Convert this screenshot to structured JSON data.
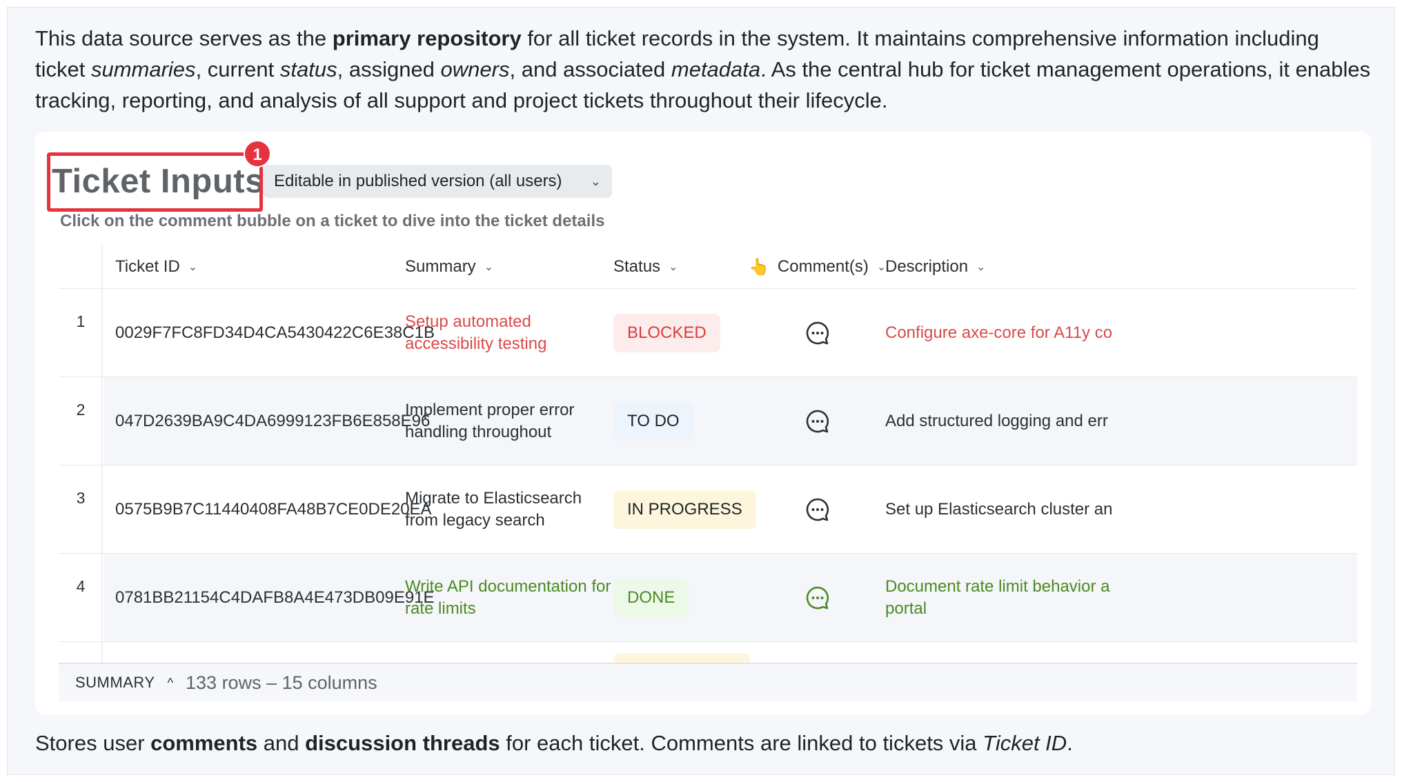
{
  "intro": {
    "p1": "This data source serves as the ",
    "b1": "primary repository",
    "p2": " for all ticket records in the system. It maintains comprehensive information including ticket ",
    "i1": "summaries",
    "p3": ", current ",
    "i2": "status",
    "p4": ", assigned ",
    "i3": "owners",
    "p5": ", and associated ",
    "i4": "metadata",
    "p6": ". As the central hub for ticket management operations, it enables tracking, reporting, and analysis of all support and project tickets throughout their lifecycle."
  },
  "card": {
    "title": "Ticket Inputs",
    "badge": "1",
    "edit_mode": "Editable in published version (all users)",
    "subtitle": "Click on the comment bubble on a ticket to dive into the ticket details"
  },
  "table": {
    "columns": {
      "ticket_id": "Ticket ID",
      "summary": "Summary",
      "status": "Status",
      "comments": "Comment(s)",
      "comments_emoji": "👆",
      "description": "Description"
    },
    "rows": [
      {
        "num": "1",
        "id": "0029F7FC8FD34D4CA5430422C6E38C1B",
        "summary": "Setup automated accessibility testing",
        "status": "BLOCKED",
        "description": "Configure axe-core for A11y co"
      },
      {
        "num": "2",
        "id": "047D2639BA9C4DA6999123FB6E858E96",
        "summary": "Implement proper error handling throughout",
        "status": "TO DO",
        "description": "Add structured logging and err"
      },
      {
        "num": "3",
        "id": "0575B9B7C11440408FA48B7CE0DE20EA",
        "summary": "Migrate to Elasticsearch from legacy search",
        "status": "IN PROGRESS",
        "description": "Set up Elasticsearch cluster an"
      },
      {
        "num": "4",
        "id": "0781BB21154C4DAFB8A4E473DB09E91E",
        "summary": "Write API documentation for rate limits",
        "status": "DONE",
        "description": "Document rate limit behavior a portal"
      }
    ]
  },
  "footer": {
    "label": "SUMMARY",
    "count": "133 rows – 15 columns"
  },
  "outro": {
    "p1": "Stores user ",
    "b1": "comments",
    "p2": " and ",
    "b2": "discussion threads",
    "p3": " for each ticket. Comments are linked to tickets via ",
    "i1": "Ticket ID",
    "p4": "."
  },
  "colors": {
    "accent_red": "#e5323e",
    "blocked": "#d93c3c",
    "done": "#4b8a23"
  }
}
